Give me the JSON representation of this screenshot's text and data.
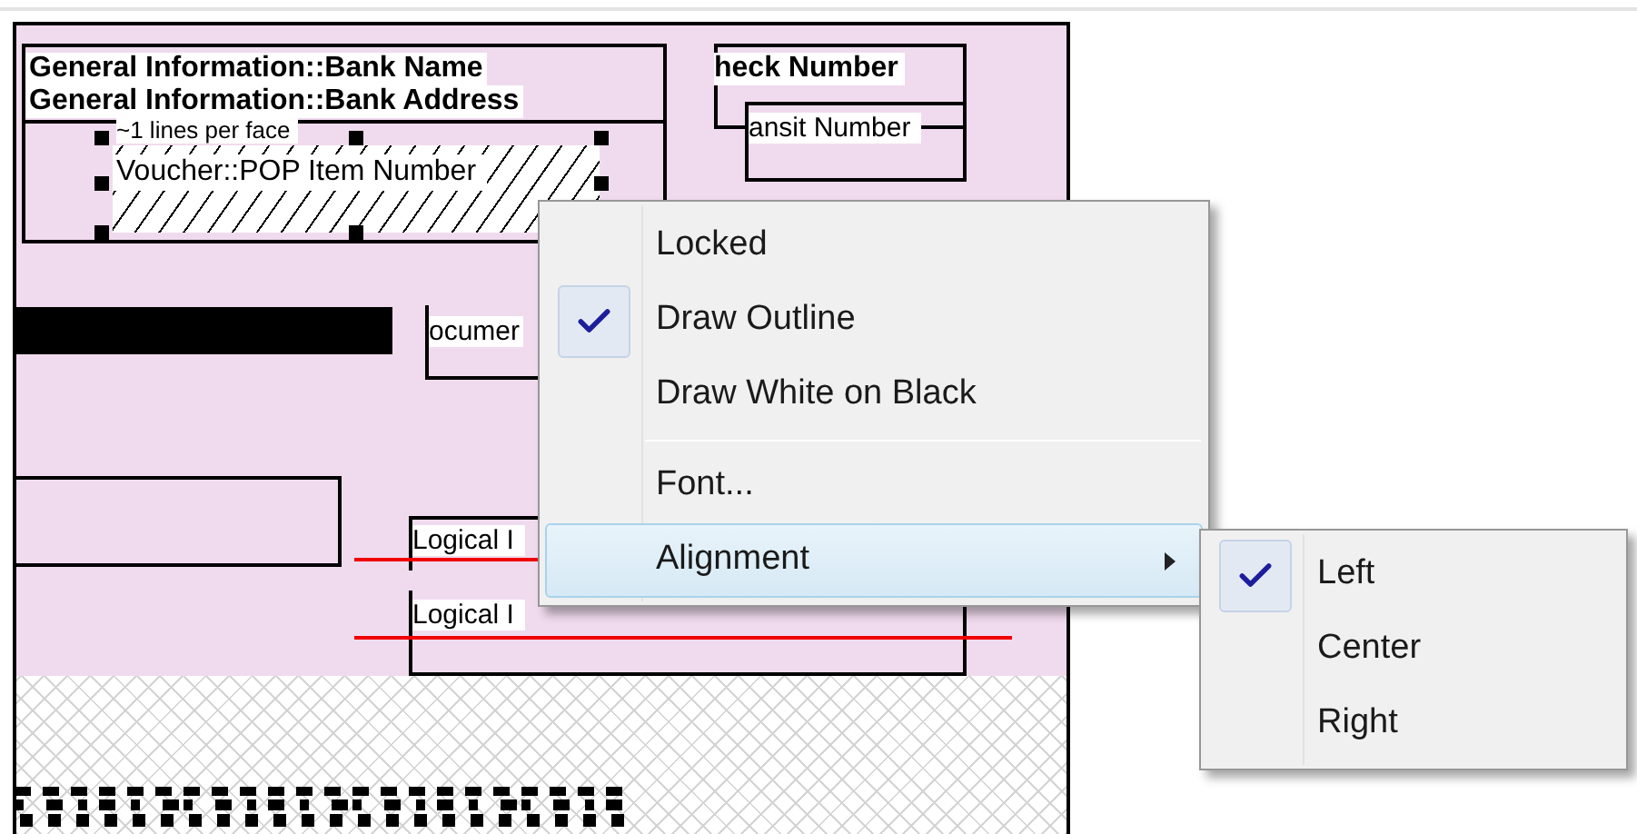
{
  "canvas": {
    "bank_name": "General Information::Bank Name",
    "bank_address": "General Information::Bank Address",
    "lines_per_face": "~1 lines per face",
    "pop_item_number": "Voucher::POP Item Number",
    "check_number": "heck Number",
    "transit_number": "ansit Number",
    "document_field": "ocumer",
    "logical_fields": [
      "Logical I",
      "Logical I"
    ]
  },
  "context_menu": {
    "items": [
      {
        "kind": "item",
        "label": "Locked",
        "checked": false,
        "selected": false
      },
      {
        "kind": "item",
        "label": "Draw Outline",
        "checked": true,
        "selected": false
      },
      {
        "kind": "item",
        "label": "Draw White on Black",
        "checked": false,
        "selected": false
      },
      {
        "kind": "separator"
      },
      {
        "kind": "item",
        "label": "Font...",
        "checked": false,
        "selected": false
      },
      {
        "kind": "submenu",
        "label": "Alignment",
        "checked": false,
        "selected": true
      }
    ]
  },
  "submenu": {
    "items": [
      {
        "label": "Left",
        "checked": true
      },
      {
        "label": "Center",
        "checked": false
      },
      {
        "label": "Right",
        "checked": false
      }
    ]
  }
}
